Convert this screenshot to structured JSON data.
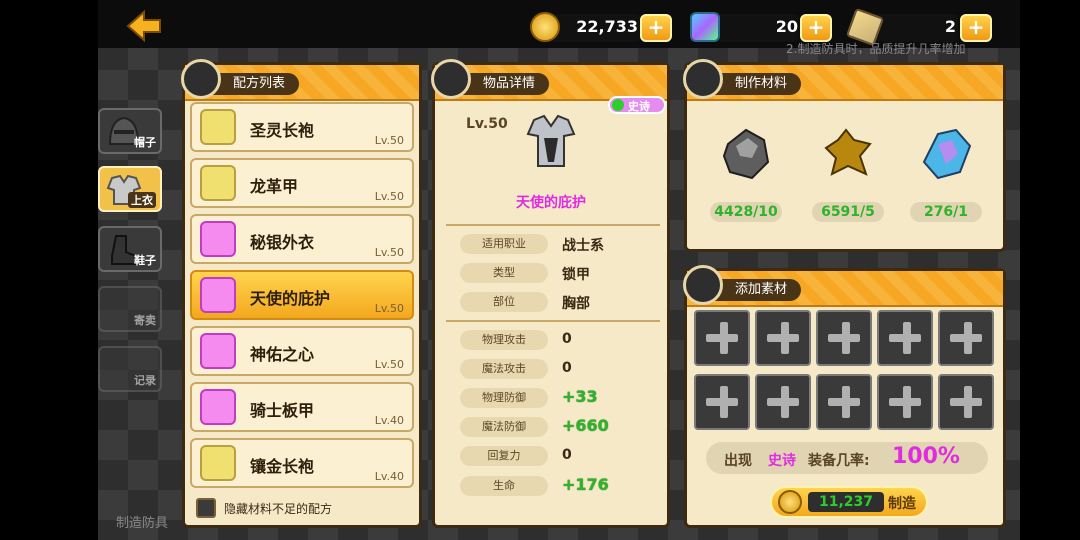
{
  "currencies": [
    {
      "name": "gold",
      "value": "22,733",
      "color": "#f2b71a"
    },
    {
      "name": "crystal",
      "value": "20",
      "color": "#3fd1c2"
    },
    {
      "name": "ticket",
      "value": "2",
      "color": "#b6c7d6"
    }
  ],
  "plus_label": "+",
  "ticker": "2.制造防具时，品质提升几率增加",
  "categories": [
    {
      "label": "帽子"
    },
    {
      "label": "上衣"
    },
    {
      "label": "鞋子"
    },
    {
      "label": "寄卖"
    },
    {
      "label": "记录"
    }
  ],
  "recipe_panel": {
    "title": "配方列表",
    "items": [
      {
        "name": "圣灵长袍",
        "lv": "Lv.50"
      },
      {
        "name": "龙革甲",
        "lv": "Lv.50"
      },
      {
        "name": "秘银外衣",
        "lv": "Lv.50"
      },
      {
        "name": "天使的庇护",
        "lv": "Lv.50"
      },
      {
        "name": "神佑之心",
        "lv": "Lv.50"
      },
      {
        "name": "骑士板甲",
        "lv": "Lv.40"
      },
      {
        "name": "镶金长袍",
        "lv": "Lv.40"
      }
    ],
    "hide_label": "隐藏材料不足的配方"
  },
  "detail_panel": {
    "title": "物品详情",
    "level": "Lv.50",
    "rarity": "史诗",
    "item_name": "天使的庇护",
    "info": [
      {
        "label": "适用职业",
        "value": "战士系"
      },
      {
        "label": "类型",
        "value": "锁甲"
      },
      {
        "label": "部位",
        "value": "胸部"
      }
    ],
    "stats": [
      {
        "label": "物理攻击",
        "value": "0"
      },
      {
        "label": "魔法攻击",
        "value": "0"
      },
      {
        "label": "物理防御",
        "value": "+33"
      },
      {
        "label": "魔法防御",
        "value": "+660"
      },
      {
        "label": "回复力",
        "value": "0"
      },
      {
        "label": "生命",
        "value": "+176"
      }
    ]
  },
  "materials_panel": {
    "title": "制作材料",
    "items": [
      {
        "count": "4428/10"
      },
      {
        "count": "6591/5"
      },
      {
        "count": "276/1"
      }
    ]
  },
  "add_panel": {
    "title": "添加素材",
    "chance_prefix": "出现",
    "chance_rarity": "史诗",
    "chance_mid": "装备几率:",
    "chance_value": "100%",
    "cost": "11,237",
    "craft_label": "制造"
  },
  "bottom_text": "制造防具"
}
